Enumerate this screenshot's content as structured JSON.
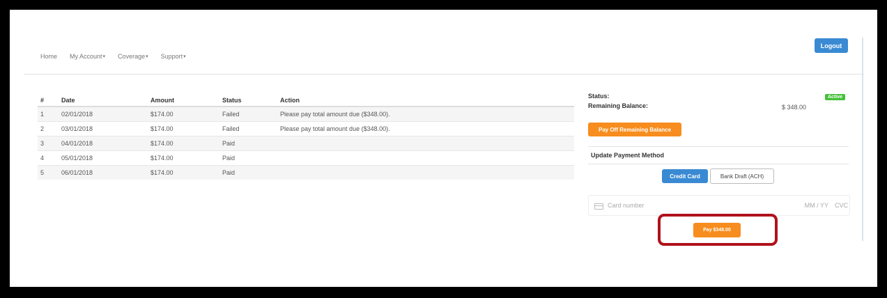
{
  "nav": {
    "home": "Home",
    "my_account": "My Account",
    "coverage": "Coverage",
    "support": "Support",
    "logout": "Logout"
  },
  "table": {
    "headers": [
      "#",
      "Date",
      "Amount",
      "Status",
      "Action"
    ],
    "rows": [
      {
        "num": "1",
        "date": "02/01/2018",
        "amount": "$174.00",
        "status": "Failed",
        "action": "Please pay total amount due ($348.00)."
      },
      {
        "num": "2",
        "date": "03/01/2018",
        "amount": "$174.00",
        "status": "Failed",
        "action": "Please pay total amount due ($348.00)."
      },
      {
        "num": "3",
        "date": "04/01/2018",
        "amount": "$174.00",
        "status": "Paid",
        "action": ""
      },
      {
        "num": "4",
        "date": "05/01/2018",
        "amount": "$174.00",
        "status": "Paid",
        "action": ""
      },
      {
        "num": "5",
        "date": "06/01/2018",
        "amount": "$174.00",
        "status": "Paid",
        "action": ""
      }
    ]
  },
  "panel": {
    "status_label": "Status:",
    "status_badge": "Active",
    "balance_label": "Remaining Balance:",
    "balance_value": "$ 348.00",
    "payoff_button": "Pay Off Remaining Balance",
    "method_title": "Update Payment Method",
    "credit_card_button": "Credit Card",
    "ach_button": "Bank Draft (ACH)",
    "card_placeholder": "Card number",
    "expiry_placeholder": "MM / YY",
    "cvc_placeholder": "CVC",
    "pay_button": "Pay $348.00"
  },
  "colors": {
    "primary": "#3a8ad3",
    "orange": "#f78d1e",
    "active": "#45c13a",
    "highlight": "#b0121b"
  }
}
